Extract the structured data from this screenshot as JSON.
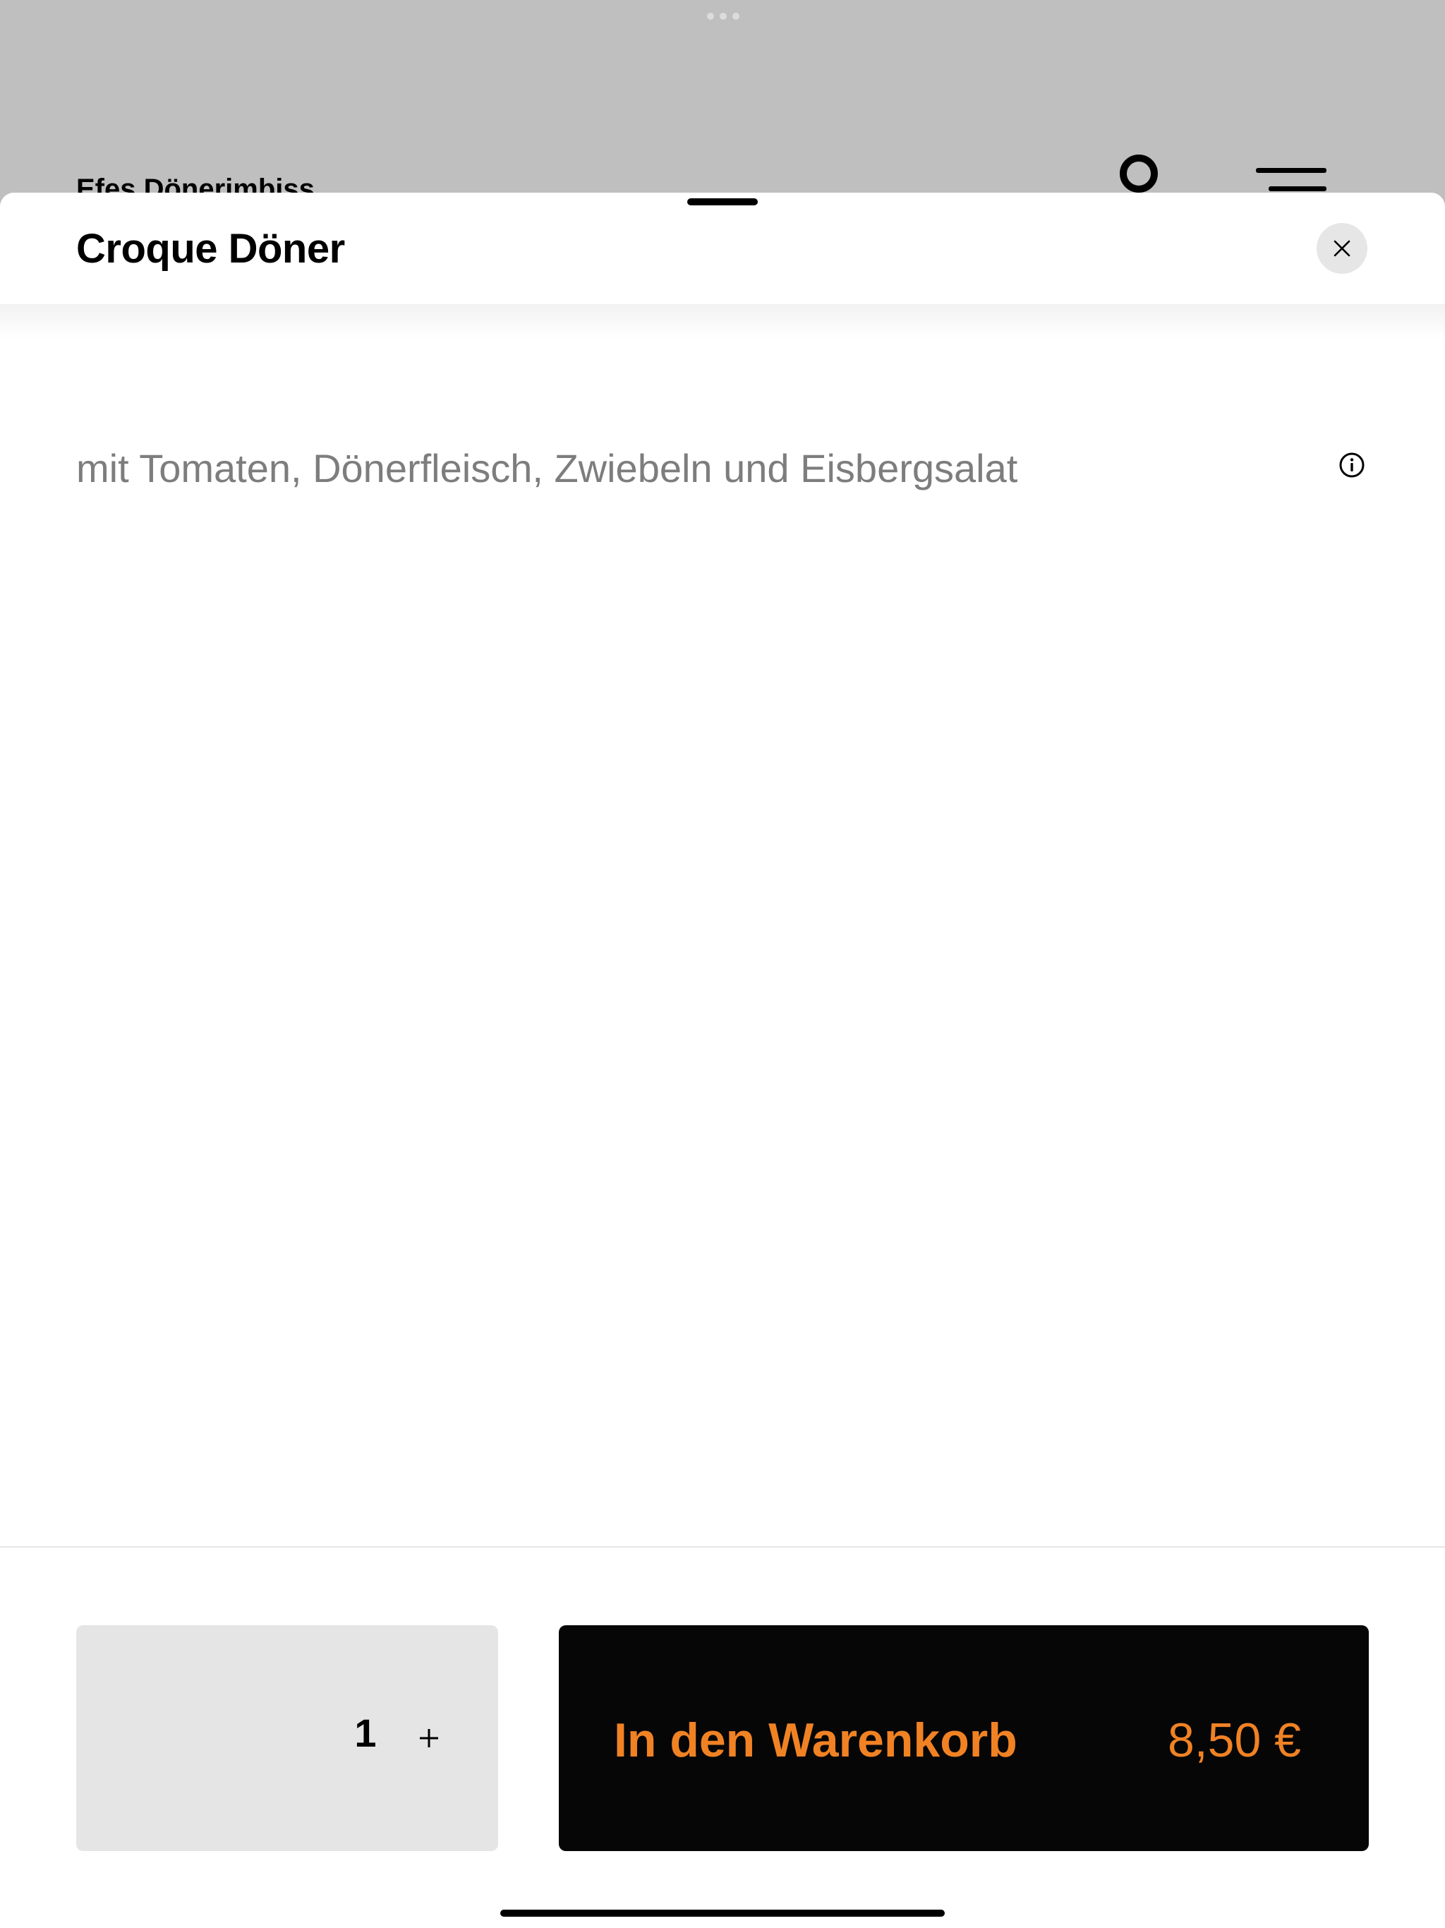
{
  "background": {
    "restaurant_name": "Efes Dönerimbiss"
  },
  "sheet": {
    "title": "Croque Döner",
    "description": "mit Tomaten, Dönerfleisch, Zwiebeln und Eisbergsalat"
  },
  "footer": {
    "quantity": "1",
    "plus_label": "+",
    "cart_label": "In den Warenkorb",
    "price": "8,50 €"
  },
  "icons": {
    "close": "close-icon",
    "info": "info-icon",
    "user": "user-icon",
    "menu": "menu-icon"
  },
  "colors": {
    "accent": "#f08224",
    "cart_button_bg": "#060606",
    "quantity_bg": "#e5e5e5",
    "backdrop": "#bfbfbf"
  }
}
